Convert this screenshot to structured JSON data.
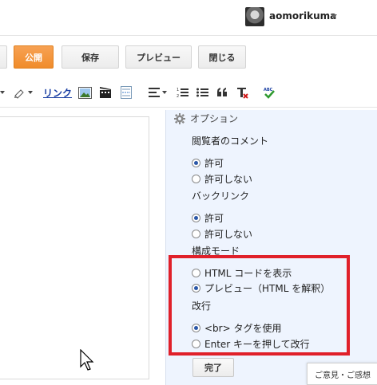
{
  "user": {
    "name": "aomorikuma"
  },
  "actions": {
    "publish": "公開",
    "save": "保存",
    "preview": "プレビュー",
    "close": "閉じる"
  },
  "toolbar": {
    "link": "リンク",
    "icons": [
      "highlighter-icon",
      "image-icon",
      "video-icon",
      "jump-break-icon",
      "align-icon",
      "numbered-list-icon",
      "bullet-list-icon",
      "quote-icon",
      "remove-format-icon",
      "spellcheck-icon"
    ]
  },
  "options": {
    "header": "オプション",
    "comments": {
      "label": "閲覧者のコメント",
      "allow": "許可",
      "disallow": "許可しない",
      "selected": "allow"
    },
    "backlinks": {
      "label": "バックリンク",
      "allow": "許可",
      "disallow": "許可しない",
      "selected": "allow"
    },
    "compose_mode": {
      "label": "構成モード",
      "html": "HTML コードを表示",
      "preview": "プレビュー（HTML を解釈）",
      "selected": "preview"
    },
    "line_breaks": {
      "label": "改行",
      "br": "<br> タグを使用",
      "enter": "Enter キーを押して改行",
      "selected": "br"
    },
    "done": "完了"
  },
  "feedback": "ご意見・ご感想",
  "colors": {
    "publish_orange": "#f08c2b",
    "panel_bg": "#eef4fe",
    "highlight_red": "#e0202a",
    "link_blue": "#1a3fa3"
  }
}
